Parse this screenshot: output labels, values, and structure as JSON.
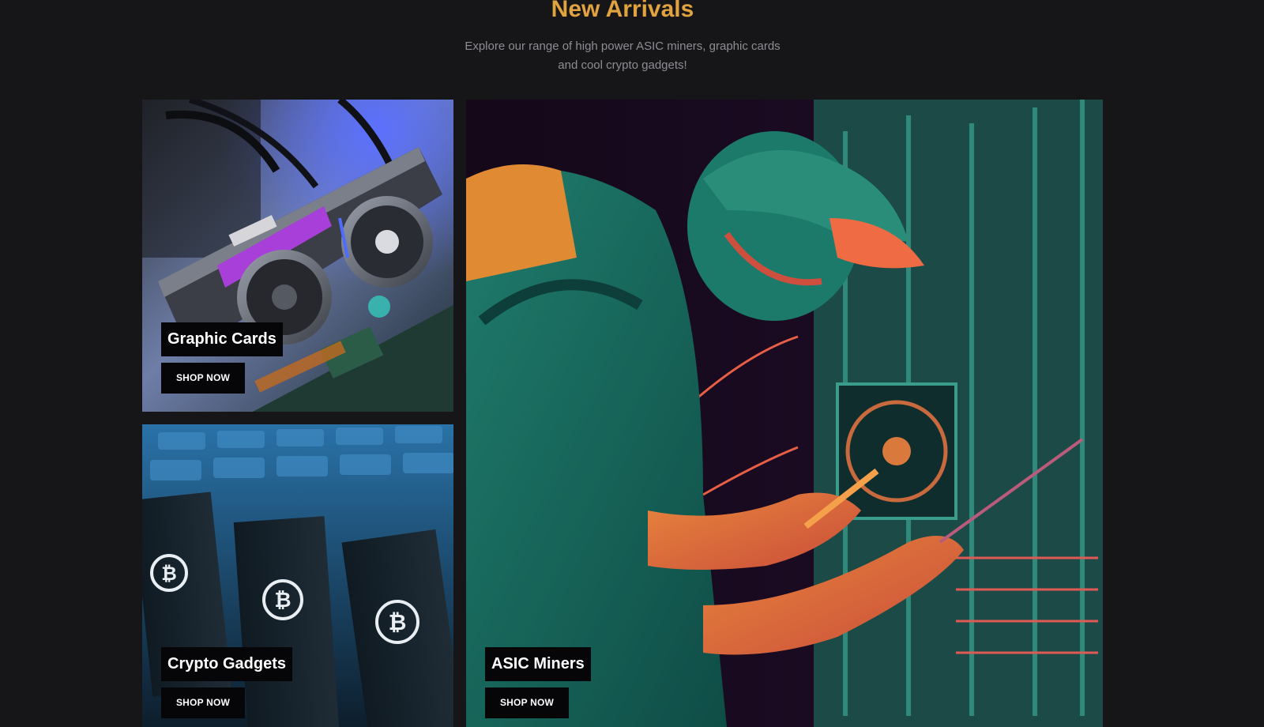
{
  "header": {
    "title": "New Arrivals",
    "subtitle": "Explore our range of high power ASIC miners, graphic cards and cool crypto gadgets!"
  },
  "categories": [
    {
      "label": "Graphic Cards",
      "button": "SHOP NOW"
    },
    {
      "label": "Crypto Gadgets",
      "button": "SHOP NOW"
    },
    {
      "label": "ASIC Miners",
      "button": "SHOP NOW"
    }
  ],
  "colors": {
    "background": "#161618",
    "title": "#e0a33f",
    "subtitle": "#8d8d93",
    "label_bg": "#060608"
  }
}
